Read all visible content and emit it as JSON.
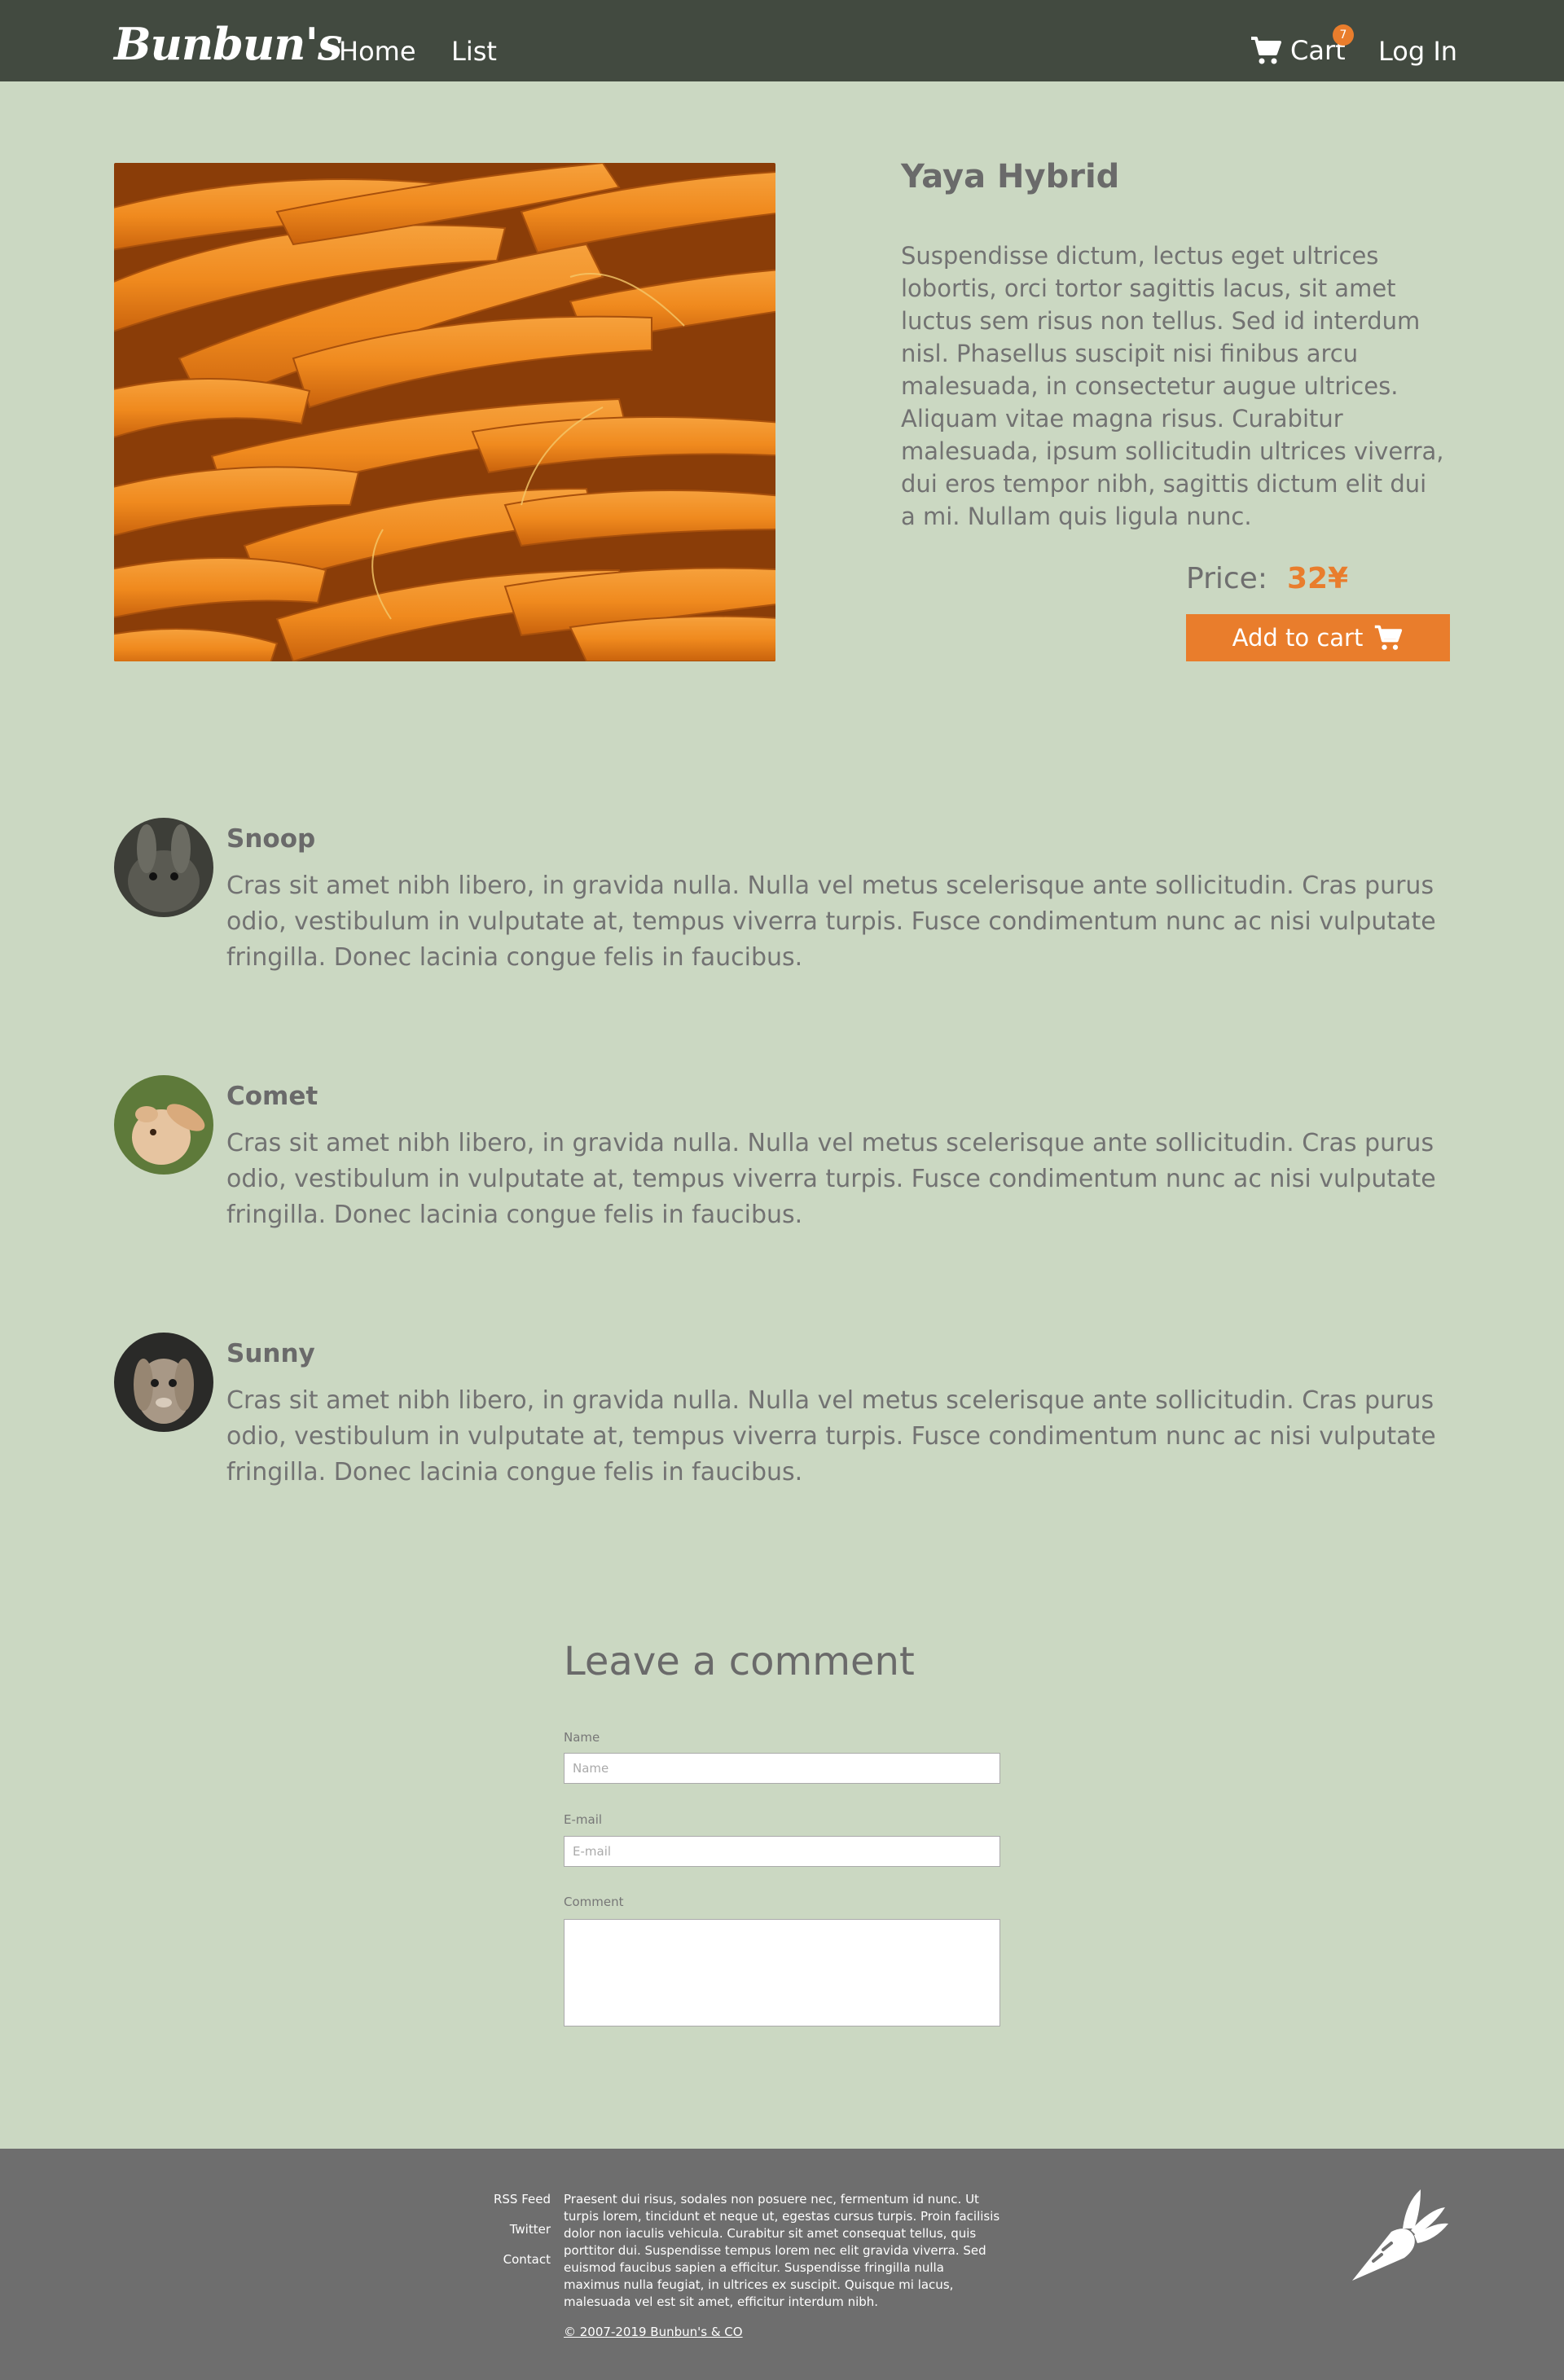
{
  "header": {
    "logo": "Bunbun's",
    "nav": {
      "home": "Home",
      "list": "List"
    },
    "cart_label": "Cart",
    "cart_count": "7",
    "login": "Log In"
  },
  "product": {
    "title": "Yaya Hybrid",
    "description": "Suspendisse dictum, lectus eget ultrices lobortis, orci tortor sagittis lacus, sit amet luctus sem risus non tellus. Sed id interdum nisl. Phasellus suscipit nisi finibus arcu malesuada, in consectetur augue ultrices. Aliquam vitae magna risus. Curabitur malesuada, ipsum sollicitudin ultrices viverra, dui eros tempor nibh, sagittis dictum elit dui a mi. Nullam quis ligula nunc.",
    "price_label": "Price:",
    "price": "32¥",
    "add_to_cart": "Add to cart"
  },
  "reviews": [
    {
      "name": "Snoop",
      "text": "Cras sit amet nibh libero, in gravida nulla. Nulla vel metus scelerisque ante sollicitudin. Cras purus odio, vestibulum in vulputate at, tempus viverra turpis. Fusce condimentum nunc ac nisi vulputate fringilla. Donec lacinia congue felis in faucibus."
    },
    {
      "name": "Comet",
      "text": "Cras sit amet nibh libero, in gravida nulla. Nulla vel metus scelerisque ante sollicitudin. Cras purus odio, vestibulum in vulputate at, tempus viverra turpis. Fusce condimentum nunc ac nisi vulputate fringilla. Donec lacinia congue felis in faucibus."
    },
    {
      "name": "Sunny",
      "text": "Cras sit amet nibh libero, in gravida nulla. Nulla vel metus scelerisque ante sollicitudin. Cras purus odio, vestibulum in vulputate at, tempus viverra turpis. Fusce condimentum nunc ac nisi vulputate fringilla. Donec lacinia congue felis in faucibus."
    }
  ],
  "comment_form": {
    "title": "Leave a comment",
    "name_label": "Name",
    "name_placeholder": "Name",
    "email_label": "E-mail",
    "email_placeholder": "E-mail",
    "comment_label": "Comment"
  },
  "footer": {
    "links": [
      "RSS Feed",
      "Twitter",
      "Contact"
    ],
    "text": "Praesent dui risus, sodales non posuere nec, fermentum id nunc. Ut turpis lorem, tincidunt et neque ut, egestas cursus turpis. Proin facilisis dolor non iaculis vehicula. Curabitur sit amet consequat tellus, quis porttitor dui. Suspendisse tempus lorem nec elit gravida viverra. Sed euismod faucibus sapien a efficitur. Suspendisse fringilla nulla maximus nulla feugiat, in ultrices ex suscipit. Quisque mi lacus, malesuada vel est sit amet, efficitur interdum nibh.",
    "copyright": "© 2007-2019 Bunbun's & CO"
  },
  "colors": {
    "header_bg": "#424a40",
    "page_bg": "#cbd8c2",
    "accent": "#e97d2c",
    "footer_bg": "#6e6e6e"
  },
  "icons": [
    "cart-icon",
    "carrot-logo-icon"
  ]
}
